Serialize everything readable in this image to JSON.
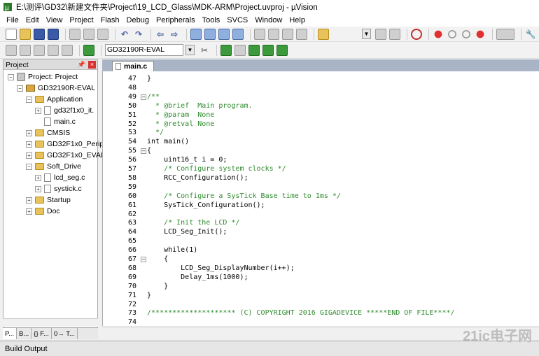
{
  "window": {
    "title": "E:\\测评\\GD32\\新建文件夹\\Project\\19_LCD_Glass\\MDK-ARM\\Project.uvproj - µVision"
  },
  "menu": [
    "File",
    "Edit",
    "View",
    "Project",
    "Flash",
    "Debug",
    "Peripherals",
    "Tools",
    "SVCS",
    "Window",
    "Help"
  ],
  "toolbar": {
    "target": "GD32190R-EVAL"
  },
  "project_panel": {
    "title": "Project",
    "tree": [
      {
        "label": "Project: Project",
        "level": 0,
        "expander": "⊟",
        "icon": "project-icon"
      },
      {
        "label": "GD32190R-EVAL",
        "level": 1,
        "expander": "⊟",
        "icon": "target-icon"
      },
      {
        "label": "Application",
        "level": 2,
        "expander": "⊟",
        "icon": "folder-icon"
      },
      {
        "label": "gd32f1x0_it.",
        "level": 3,
        "expander": "⊞",
        "icon": "file-icon"
      },
      {
        "label": "main.c",
        "level": 3,
        "expander": "",
        "icon": "file-icon"
      },
      {
        "label": "CMSIS",
        "level": 2,
        "expander": "⊞",
        "icon": "folder-icon"
      },
      {
        "label": "GD32F1x0_Perip",
        "level": 2,
        "expander": "⊞",
        "icon": "folder-icon"
      },
      {
        "label": "GD32F1x0_EVAL",
        "level": 2,
        "expander": "⊞",
        "icon": "folder-icon"
      },
      {
        "label": "Soft_Drive",
        "level": 2,
        "expander": "⊟",
        "icon": "folder-icon"
      },
      {
        "label": "lcd_seg.c",
        "level": 3,
        "expander": "⊞",
        "icon": "file-icon"
      },
      {
        "label": "systick.c",
        "level": 3,
        "expander": "⊞",
        "icon": "file-icon"
      },
      {
        "label": "Startup",
        "level": 2,
        "expander": "⊞",
        "icon": "folder-icon"
      },
      {
        "label": "Doc",
        "level": 2,
        "expander": "⊞",
        "icon": "folder-icon"
      }
    ],
    "tabs": [
      "P...",
      "B...",
      "{} F...",
      "0→ T..."
    ]
  },
  "editor": {
    "active_tab": "main.c",
    "lines": [
      {
        "n": "47",
        "text": "}",
        "fold": ""
      },
      {
        "n": "48",
        "text": "",
        "fold": ""
      },
      {
        "n": "49",
        "text": "/**",
        "fold": "−",
        "cls": "cmt"
      },
      {
        "n": "50",
        "text": "  * @brief  Main program.",
        "fold": "",
        "cls": "cmt"
      },
      {
        "n": "51",
        "text": "  * @param  None",
        "fold": "",
        "cls": "cmt"
      },
      {
        "n": "52",
        "text": "  * @retval None",
        "fold": "",
        "cls": "cmt"
      },
      {
        "n": "53",
        "text": "  */",
        "fold": "",
        "cls": "cmt"
      },
      {
        "n": "54",
        "text": "int main()",
        "fold": ""
      },
      {
        "n": "55",
        "text": "{",
        "fold": "−"
      },
      {
        "n": "56",
        "text": "    uint16_t i = 0;",
        "fold": ""
      },
      {
        "n": "57",
        "text": "    /* Configure system clocks */",
        "fold": "",
        "cls": "cmt"
      },
      {
        "n": "58",
        "text": "    RCC_Configuration();",
        "fold": ""
      },
      {
        "n": "59",
        "text": "",
        "fold": ""
      },
      {
        "n": "60",
        "text": "    /* Configure a SysTick Base time to 1ms */",
        "fold": "",
        "cls": "cmt"
      },
      {
        "n": "61",
        "text": "    SysTick_Configuration();",
        "fold": ""
      },
      {
        "n": "62",
        "text": "",
        "fold": ""
      },
      {
        "n": "63",
        "text": "    /* Init the LCD */",
        "fold": "",
        "cls": "cmt"
      },
      {
        "n": "64",
        "text": "    LCD_Seg_Init();",
        "fold": ""
      },
      {
        "n": "65",
        "text": "",
        "fold": ""
      },
      {
        "n": "66",
        "text": "    while(1)",
        "fold": ""
      },
      {
        "n": "67",
        "text": "    {",
        "fold": "−"
      },
      {
        "n": "68",
        "text": "        LCD_Seg_DisplayNumber(i++);",
        "fold": ""
      },
      {
        "n": "69",
        "text": "        Delay_1ms(1000);",
        "fold": ""
      },
      {
        "n": "70",
        "text": "    }",
        "fold": ""
      },
      {
        "n": "71",
        "text": "}",
        "fold": ""
      },
      {
        "n": "72",
        "text": "",
        "fold": ""
      },
      {
        "n": "73",
        "text": "/******************** (C) COPYRIGHT 2016 GIGADEVICE *****END OF FILE****/",
        "fold": "",
        "cls": "cmt"
      },
      {
        "n": "74",
        "text": "",
        "fold": ""
      }
    ]
  },
  "status": {
    "build_output": "Build Output"
  },
  "watermark": "21ic电子网"
}
